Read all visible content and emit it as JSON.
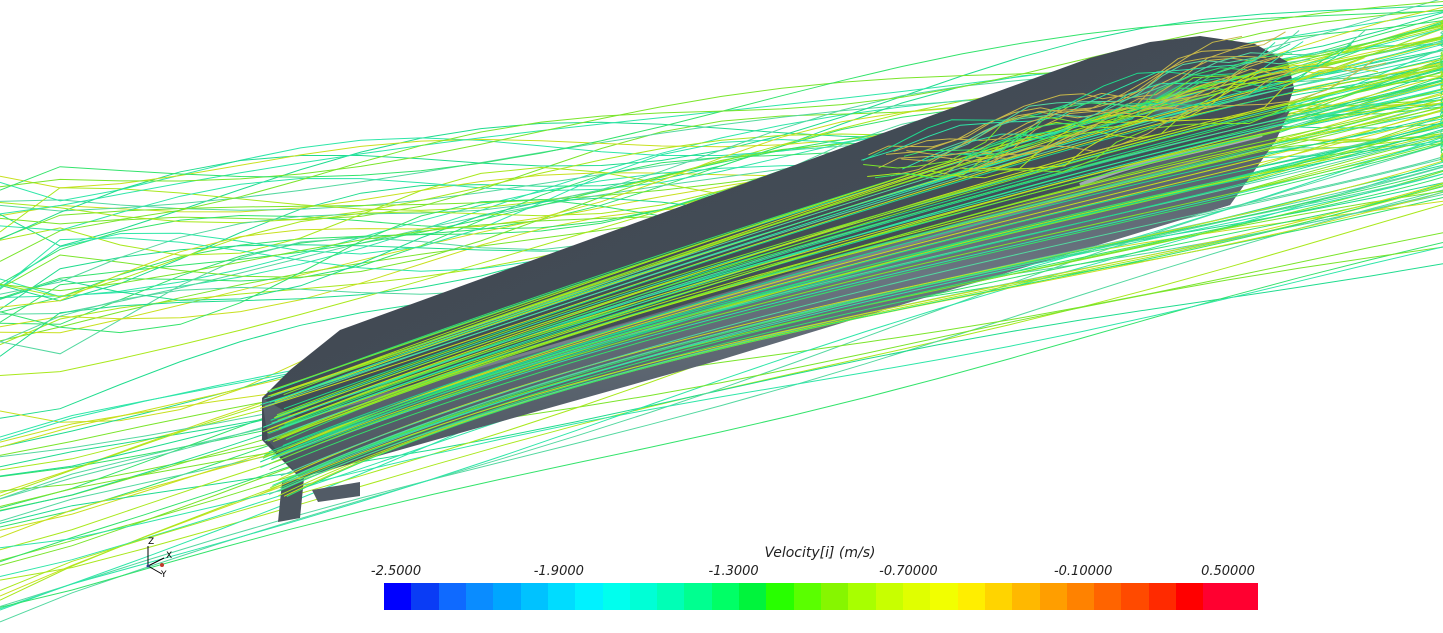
{
  "legend": {
    "title": "Velocity[i] (m/s)",
    "ticks": [
      "-2.5000",
      "-1.9000",
      "-1.3000",
      "-0.70000",
      "-0.10000",
      "0.50000"
    ],
    "segments": [
      "#0000ff",
      "#0a3cf5",
      "#0f6aff",
      "#0a8cff",
      "#00a6ff",
      "#00c2ff",
      "#00dcff",
      "#00f2ff",
      "#00ffee",
      "#00ffd6",
      "#00ffb6",
      "#00ff90",
      "#00ff66",
      "#00f43c",
      "#28ff00",
      "#5aff00",
      "#86f600",
      "#a8ff00",
      "#c8ff00",
      "#e0ff00",
      "#f2ff00",
      "#ffee00",
      "#ffd400",
      "#ffb800",
      "#ff9e00",
      "#ff8200",
      "#ff6400",
      "#ff4a00",
      "#ff2a00",
      "#ff0000",
      "#ff0030",
      "#ff0030"
    ]
  },
  "triad": {
    "z_label": "Z",
    "x_label": "X",
    "y_label": "Y"
  },
  "scene": {
    "hull_color": "#5c6671",
    "streamline_colors": [
      "#2ee6a8",
      "#1fdc8e",
      "#33e36b",
      "#7ae52a",
      "#a9e81c",
      "#c8e01e",
      "#54d8a0"
    ]
  }
}
